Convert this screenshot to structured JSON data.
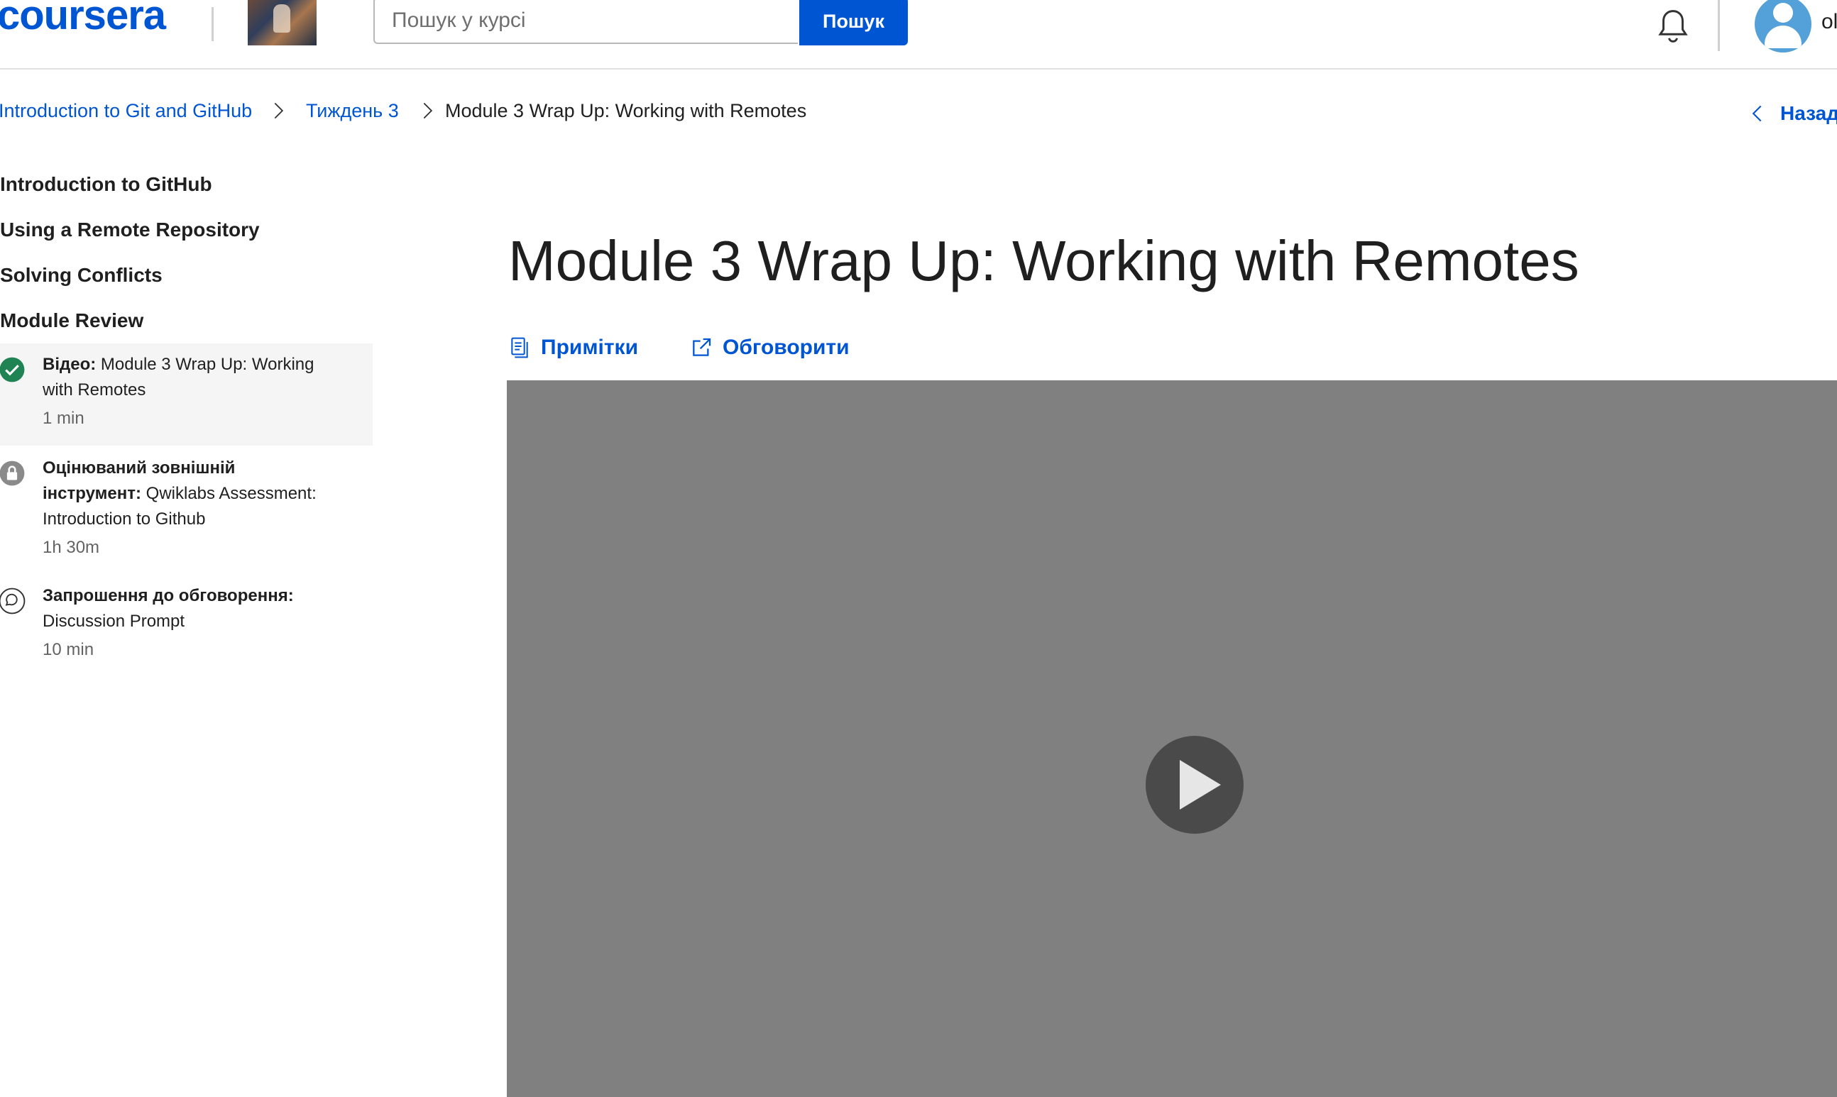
{
  "header": {
    "logo": "coursera",
    "search_placeholder": "Пошук у курсі",
    "search_button": "Пошук",
    "user_initials": "ol",
    "icons": [
      "bell-icon",
      "avatar-icon"
    ]
  },
  "breadcrumb": {
    "course": "Introduction to Git and GitHub",
    "week": "Тиждень 3",
    "current": "Module 3 Wrap Up: Working with Remotes",
    "back": "Назад"
  },
  "sidebar": {
    "sections": [
      "Introduction to GitHub",
      "Using a Remote Repository",
      "Solving Conflicts",
      "Module Review"
    ],
    "items": [
      {
        "type_label": "Відео:",
        "title_line1": "Module 3 Wrap Up: Working",
        "title_line2": "with Remotes",
        "duration": "1 min",
        "status": "completed",
        "icon": "check-circle-icon"
      },
      {
        "type_label_line1": "Оцінюваний зовнішній",
        "type_label_line2": "інструмент:",
        "title_line2": "Qwiklabs Assessment:",
        "title_line3": "Introduction to Github",
        "duration": "1h 30m",
        "status": "locked",
        "icon": "lock-icon"
      },
      {
        "type_label": "Запрошення до обговорення:",
        "title": "Discussion Prompt",
        "duration": "10 min",
        "status": "not-started",
        "icon": "chat-bubble-icon"
      }
    ]
  },
  "main": {
    "title": "Module 3 Wrap Up: Working with Remotes",
    "notes_label": "Примітки",
    "discuss_label": "Обговорити"
  },
  "colors": {
    "brand": "#0056d2",
    "completed": "#1f8354",
    "video_bg": "#808080"
  }
}
